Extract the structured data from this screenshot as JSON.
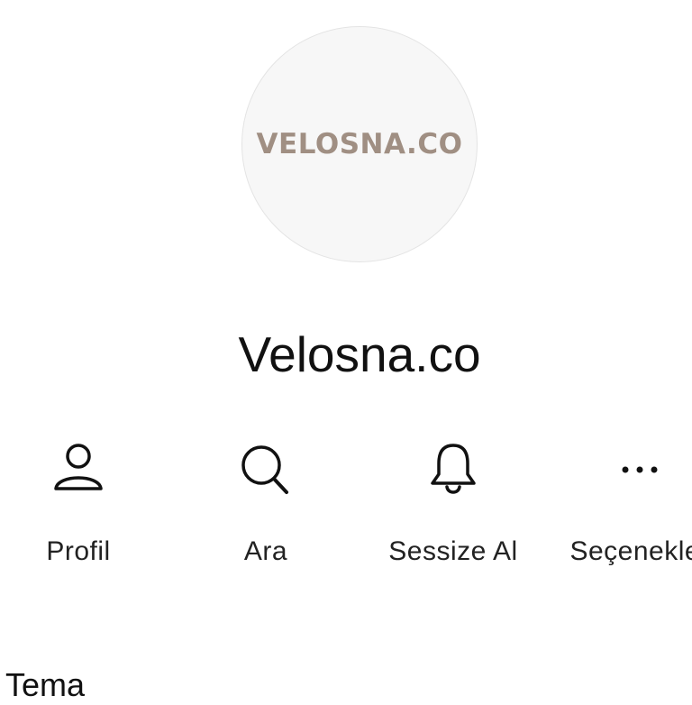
{
  "profile": {
    "logo_text": "VELOSNA.CO",
    "name": "Velosna.co"
  },
  "actions": [
    {
      "label": "Profil",
      "icon": "person-icon"
    },
    {
      "label": "Ara",
      "icon": "search-icon"
    },
    {
      "label": "Sessize Al",
      "icon": "bell-icon"
    },
    {
      "label": "Seçenekler",
      "icon": "more-icon"
    }
  ],
  "sections": {
    "theme_title": "Tema"
  },
  "colors": {
    "logo": "#a08f83",
    "text": "#111111",
    "avatar_bg": "#f7f7f7"
  }
}
